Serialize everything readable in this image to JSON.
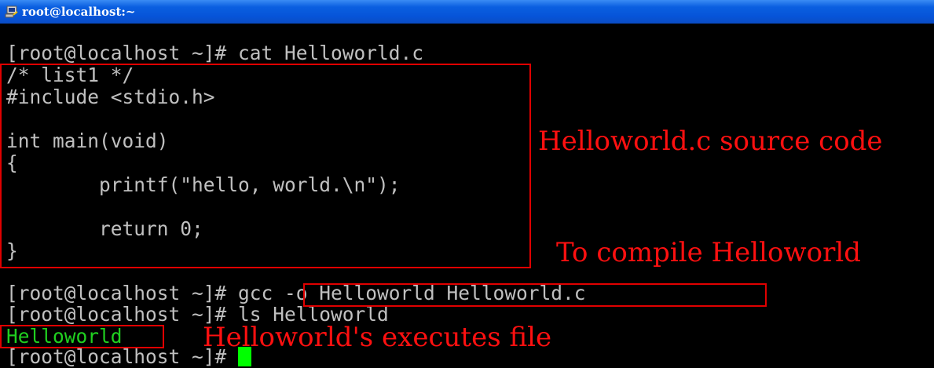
{
  "window": {
    "title": "root@localhost:~"
  },
  "terminal": {
    "lines": [
      "[root@localhost ~]# cat Helloworld.c",
      "/* list1 */",
      "#include <stdio.h>",
      "",
      "int main(void)",
      "{",
      "        printf(\"hello, world.\\n\");",
      "",
      "        return 0;",
      "}",
      "",
      "[root@localhost ~]# gcc -o Helloworld Helloworld.c",
      "[root@localhost ~]# ls Helloworld",
      "Helloworld",
      "[root@localhost ~]# "
    ]
  },
  "annotations": {
    "source": "Helloworld.c source code",
    "compile": "To compile Helloworld",
    "executes": "Helloworld's executes file"
  },
  "colors": {
    "annotation": "#ff1010",
    "output": "#20d020",
    "cursor": "#00ff00",
    "titlebar": "#0a5fe0"
  }
}
